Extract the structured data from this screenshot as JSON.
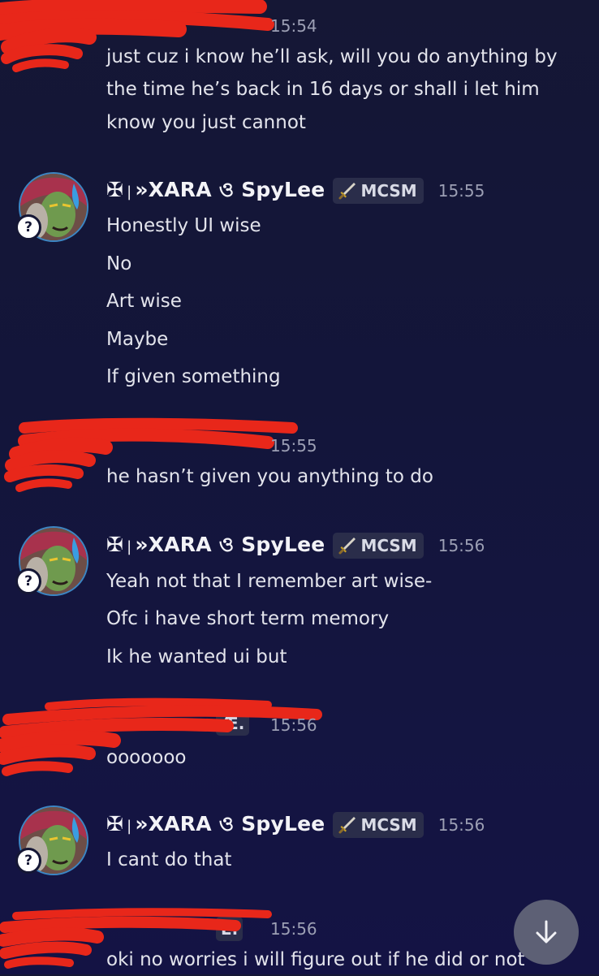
{
  "messages": [
    {
      "author_hidden": true,
      "time": "15:54",
      "lines": [
        "just cuz i know he’ll ask, will you do anything by",
        "the time he’s back in 16 days or shall i let him",
        "know you just cannot"
      ]
    },
    {
      "author": {
        "prefix": "✠",
        "bar": "|",
        "name": "»XARA ও SpyLee",
        "tag": "MCSM"
      },
      "time": "15:55",
      "lines": [
        "Honestly UI wise",
        "No",
        "Art wise",
        "Maybe",
        "If given something"
      ]
    },
    {
      "author_hidden": true,
      "time": "15:55",
      "lines": [
        "he hasn’t given you anything to do"
      ]
    },
    {
      "author": {
        "prefix": "✠",
        "bar": "|",
        "name": "»XARA ও SpyLee",
        "tag": "MCSM"
      },
      "time": "15:56",
      "lines": [
        "Yeah not that I remember art wise-",
        "Ofc i have short term memory",
        "Ik he wanted ui but"
      ]
    },
    {
      "author_hidden": true,
      "name_fragment": "Æ.",
      "time": "15:56",
      "lines": [
        "ooooooo"
      ]
    },
    {
      "author": {
        "prefix": "✠",
        "bar": "|",
        "name": "»XARA ও SpyLee",
        "tag": "MCSM"
      },
      "time": "15:56",
      "lines": [
        "I cant do that"
      ]
    },
    {
      "author_hidden": true,
      "name_fragment": "E.",
      "time": "15:56",
      "lines": [
        "oki no worries i will figure out if he did or not"
      ]
    }
  ],
  "icons": {
    "avatar_badge": "help-question-icon",
    "role_tag_icon": "sword-icon",
    "scroll_button": "arrow-down-icon"
  },
  "colors": {
    "background": "#141541",
    "redaction": "#e8271a",
    "avatar_ring": "#3c86c4",
    "scroll_button": "#5d6075"
  }
}
